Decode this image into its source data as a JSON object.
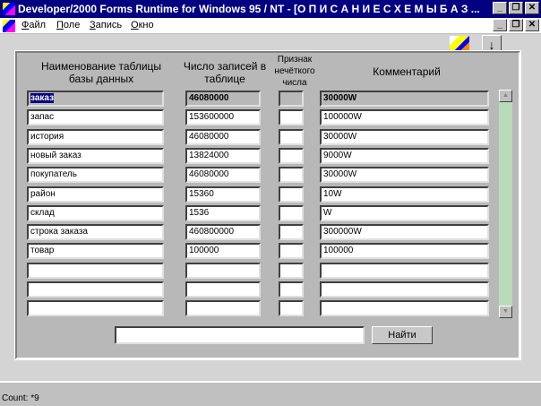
{
  "window": {
    "title": "Developer/2000 Forms Runtime for Windows 95 / NT - [О П И С А Н И Е     С Х Е М Ы     Б А З ..."
  },
  "menu": [
    "Файл",
    "Поле",
    "Запись",
    "Окно"
  ],
  "headers": {
    "name": "Наименование таблицы базы данных",
    "count": "Число записей в таблице",
    "fuzzy": "Признак нечёткого числа",
    "comment": "Комментарий"
  },
  "rows": [
    {
      "name": "заказ",
      "count": "46080000",
      "fuzzy": "",
      "comment": "30000W"
    },
    {
      "name": "запас",
      "count": "153600000",
      "fuzzy": "",
      "comment": "100000W"
    },
    {
      "name": "история",
      "count": "46080000",
      "fuzzy": "",
      "comment": "30000W"
    },
    {
      "name": "новый заказ",
      "count": "13824000",
      "fuzzy": "",
      "comment": "9000W"
    },
    {
      "name": "покупатель",
      "count": "46080000",
      "fuzzy": "",
      "comment": "30000W"
    },
    {
      "name": "район",
      "count": "15360",
      "fuzzy": "",
      "comment": "10W"
    },
    {
      "name": "склад",
      "count": "1536",
      "fuzzy": "",
      "comment": "W"
    },
    {
      "name": "строка заказа",
      "count": "460800000",
      "fuzzy": "",
      "comment": "300000W"
    },
    {
      "name": "товар",
      "count": "100000",
      "fuzzy": "",
      "comment": "100000"
    },
    {
      "name": "",
      "count": "",
      "fuzzy": "",
      "comment": ""
    },
    {
      "name": "",
      "count": "",
      "fuzzy": "",
      "comment": ""
    },
    {
      "name": "",
      "count": "",
      "fuzzy": "",
      "comment": ""
    }
  ],
  "search": {
    "value": "",
    "button": "Найти"
  },
  "status": "Count: *9"
}
